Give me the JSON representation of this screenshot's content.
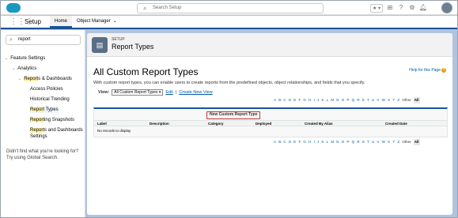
{
  "topbar": {
    "search_placeholder": "Search Setup",
    "fav_label": "★ ▾",
    "icons": [
      "add-icon",
      "help-icon",
      "gear-icon",
      "bell-icon"
    ]
  },
  "nav": {
    "app_name": "Setup",
    "tabs": [
      {
        "label": "Home"
      },
      {
        "label": "Object Manager"
      }
    ]
  },
  "sidebar": {
    "quick_find": "report",
    "items": [
      {
        "label": "Feature Settings"
      },
      {
        "label": "Analytics"
      },
      {
        "label_hl": "Report",
        "label_rest": "s & Dashboards"
      },
      {
        "label": "Access Policies"
      },
      {
        "label": "Historical Trending"
      },
      {
        "label_hl": "Report",
        "label_rest": " Types"
      },
      {
        "label_hl": "Report",
        "label_rest": "ing Snapshots"
      },
      {
        "label_hl": "Report",
        "label_rest": "s and Dashboards"
      },
      {
        "label": "Settings"
      }
    ],
    "hint_line1": "Didn't find what you're looking for?",
    "hint_line2": "Try using Global Search."
  },
  "header": {
    "section": "SETUP",
    "title": "Report Types"
  },
  "main": {
    "heading": "All Custom Report Types",
    "help_link": "Help for this Page",
    "description": "With custom report types, you can enable users to create reports from the predefined objects, object relationships, and fields that you specify.",
    "view_label": "View:",
    "view_value": "All Custom Report Types",
    "edit_link": "Edit",
    "sep": "|",
    "create_view_link": "Create New View",
    "alphabet": [
      "A",
      "B",
      "C",
      "D",
      "E",
      "F",
      "G",
      "H",
      "I",
      "J",
      "K",
      "L",
      "M",
      "N",
      "O",
      "P",
      "Q",
      "R",
      "S",
      "T",
      "U",
      "V",
      "W",
      "X",
      "Y",
      "Z"
    ],
    "other_label": "Other",
    "all_label": "All",
    "new_button": "New Custom Report Type",
    "columns": [
      "Label",
      "Description",
      "Category",
      "Deployed",
      "Created By Alias",
      "Created Date"
    ],
    "no_records": "No records to display"
  },
  "colors": {
    "brand": "#1b5297",
    "highlight": "#fff2a6",
    "button_outline": "#c23934",
    "background": "#b0c4df"
  }
}
